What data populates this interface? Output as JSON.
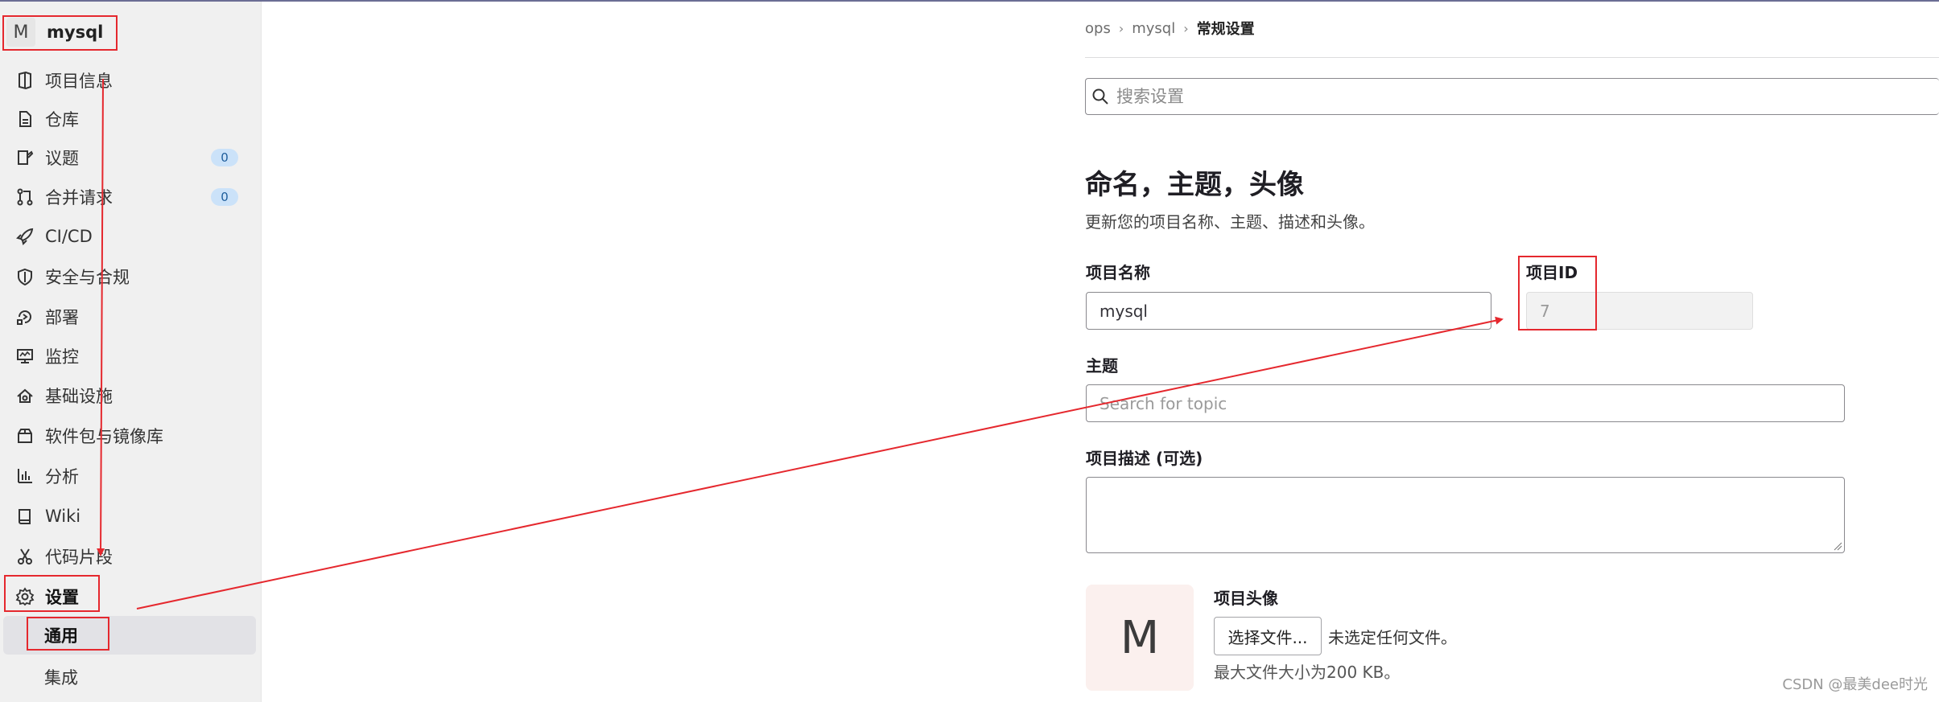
{
  "project": {
    "avatar_letter": "M",
    "name": "mysql"
  },
  "sidebar": {
    "items": [
      {
        "label": "项目信息",
        "icon": "project-info-icon"
      },
      {
        "label": "仓库",
        "icon": "repository-icon"
      },
      {
        "label": "议题",
        "icon": "issues-icon",
        "count": "0"
      },
      {
        "label": "合并请求",
        "icon": "merge-request-icon",
        "count": "0"
      },
      {
        "label": "CI/CD",
        "icon": "rocket-icon"
      },
      {
        "label": "安全与合规",
        "icon": "shield-icon"
      },
      {
        "label": "部署",
        "icon": "deployments-icon"
      },
      {
        "label": "监控",
        "icon": "monitor-icon"
      },
      {
        "label": "基础设施",
        "icon": "cloud-gear-icon"
      },
      {
        "label": "软件包与镜像库",
        "icon": "package-icon"
      },
      {
        "label": "分析",
        "icon": "chart-icon"
      },
      {
        "label": "Wiki",
        "icon": "book-icon"
      },
      {
        "label": "代码片段",
        "icon": "snippet-icon"
      },
      {
        "label": "设置",
        "icon": "settings-icon"
      }
    ],
    "sub_items": [
      {
        "label": "通用"
      },
      {
        "label": "集成"
      }
    ]
  },
  "breadcrumb": [
    "ops",
    "mysql",
    "常规设置"
  ],
  "search": {
    "placeholder": "搜索设置"
  },
  "section": {
    "title": "命名，主题，头像",
    "description": "更新您的项目名称、主题、描述和头像。"
  },
  "form": {
    "name_label": "项目名称",
    "name_value": "mysql",
    "id_label": "项目ID",
    "id_value": "7",
    "topic_label": "主题",
    "topic_placeholder": "Search for topic",
    "desc_label": "项目描述 (可选)",
    "avatar_label": "项目头像",
    "avatar_letter": "M",
    "file_button": "选择文件...",
    "file_status": "未选定任何文件。",
    "file_hint": "最大文件大小为200 KB。"
  },
  "watermark": "CSDN @最美dee时光",
  "colors": {
    "annotation": "#e5282e",
    "count_badge": "#cbe2f9"
  }
}
